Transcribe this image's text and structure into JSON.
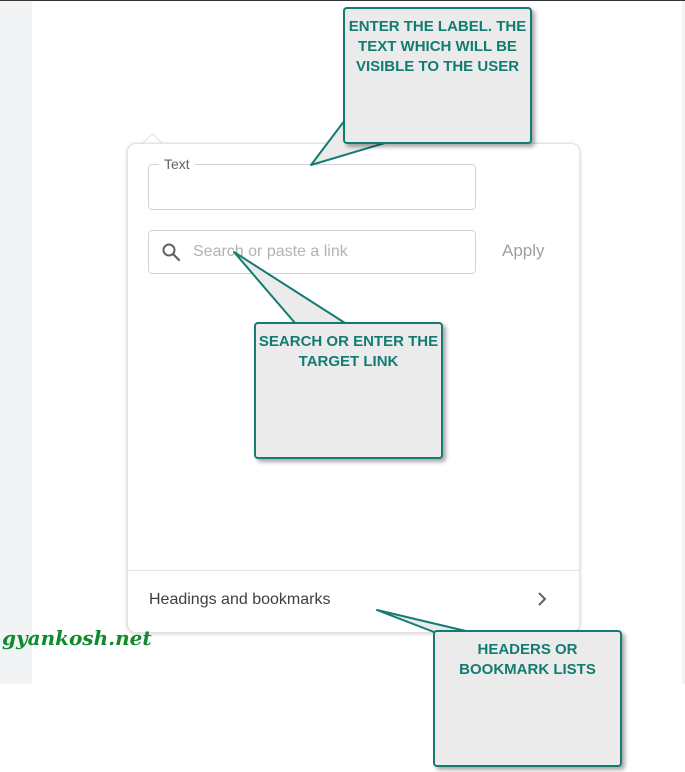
{
  "editor": {
    "link_dialog": {
      "text_field_label": "Text",
      "text_field_value": "",
      "search_placeholder": "Search or paste a link",
      "apply_label": "Apply",
      "bookmarks_label": "Headings and bookmarks"
    }
  },
  "annotations": {
    "callout_label": "ENTER THE LABEL. THE TEXT WHICH WILL BE VISIBLE TO THE USER",
    "callout_link": "SEARCH OR ENTER THE TARGET LINK",
    "callout_bookmarks": "HEADERS OR BOOKMARK LISTS"
  },
  "watermark": "gyankosh.net",
  "colors": {
    "callout_border": "#137c72",
    "callout_fill": "#ebebeb",
    "watermark": "#0f8a2c",
    "apply_disabled": "#a0a0a0"
  },
  "icons": [
    "search-icon",
    "chevron-right-icon"
  ]
}
